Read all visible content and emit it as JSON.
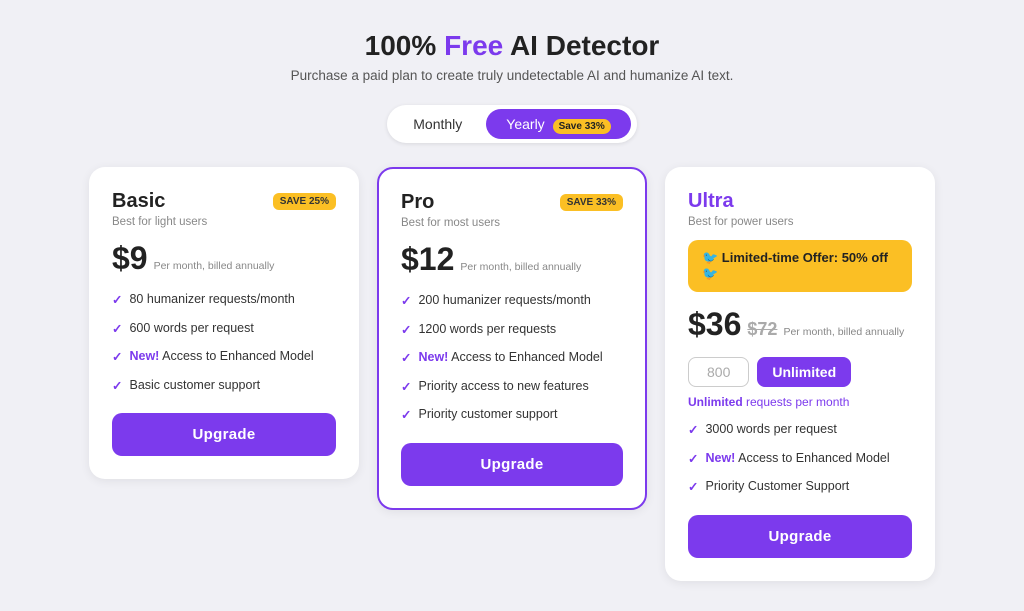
{
  "header": {
    "title_start": "100% ",
    "title_free": "Free",
    "title_end": " AI Detector",
    "subtitle": "Purchase a paid plan to create truly undetectable AI and humanize AI text."
  },
  "billing": {
    "monthly_label": "Monthly",
    "yearly_label": "Yearly",
    "yearly_save": "Save 33%",
    "active": "yearly"
  },
  "cards": [
    {
      "id": "basic",
      "name": "Basic",
      "subtitle": "Best for light users",
      "save_tag": "SAVE 25%",
      "price": "$9",
      "price_desc": "Per month, billed annually",
      "features": [
        "80 humanizer requests/month",
        "600 words per request",
        "New! Access to Enhanced Model",
        "Basic customer support"
      ],
      "upgrade_label": "Upgrade"
    },
    {
      "id": "pro",
      "name": "Pro",
      "subtitle": "Best for most users",
      "save_tag": "SAVE 33%",
      "price": "$12",
      "price_desc": "Per month, billed annually",
      "features": [
        "200 humanizer requests/month",
        "1200 words per requests",
        "New! Access to Enhanced Model",
        "Priority access to new features",
        "Priority customer support"
      ],
      "upgrade_label": "Upgrade"
    },
    {
      "id": "ultra",
      "name": "Ultra",
      "subtitle": "Best for power users",
      "offer_banner": "🐦 Limited-time Offer: 50% off 🐦",
      "price": "$36",
      "price_old": "$72",
      "price_desc": "Per month, billed annually",
      "req_option_1": "800",
      "req_option_2": "Unlimited",
      "unlimited_text": "Unlimited requests per month",
      "features": [
        "3000 words per request",
        "New! Access to Enhanced Model",
        "Priority Customer Support"
      ],
      "upgrade_label": "Upgrade"
    }
  ]
}
